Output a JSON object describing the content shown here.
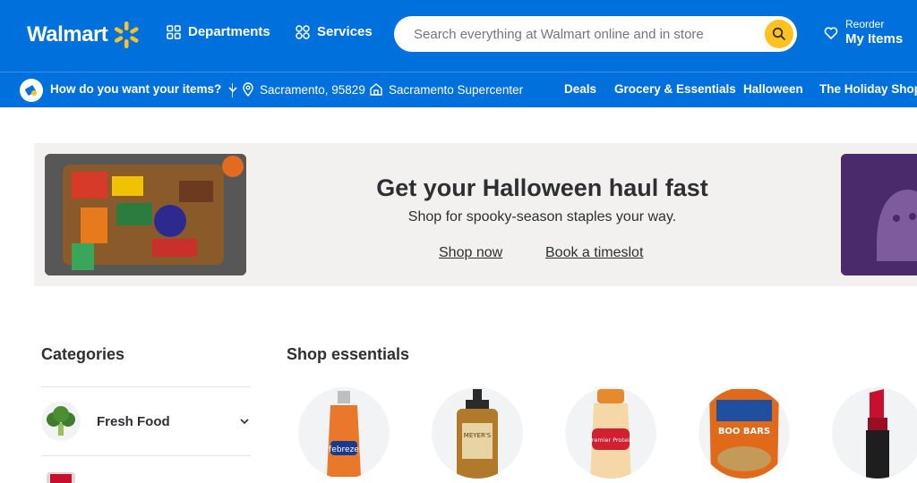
{
  "header": {
    "logo_text": "Walmart",
    "departments_label": "Departments",
    "services_label": "Services",
    "search_placeholder": "Search everything at Walmart online and in store",
    "reorder_small": "Reorder",
    "reorder_big": "My Items"
  },
  "subbar": {
    "delivery_prompt": "How do you want your items?",
    "location": "Sacramento, 95829",
    "store": "Sacramento Supercenter",
    "links": [
      "Deals",
      "Grocery & Essentials",
      "Halloween",
      "The Holiday Shop"
    ]
  },
  "banner": {
    "title": "Get your Halloween haul fast",
    "subtitle": "Shop for spooky-season staples your way.",
    "link_shop": "Shop now",
    "link_book": "Book a timeslot"
  },
  "categories": {
    "title": "Categories",
    "items": [
      {
        "label": "Fresh Food"
      }
    ]
  },
  "essentials": {
    "title": "Shop essentials",
    "products": [
      {
        "name": "febreze",
        "label": "febreze"
      },
      {
        "name": "hand-soap",
        "label": "MEYER'S"
      },
      {
        "name": "premier-protein",
        "label": "Premier Protein"
      },
      {
        "name": "blue-boo-bars",
        "label": "BOO BARS"
      },
      {
        "name": "lipstick",
        "label": ""
      }
    ]
  },
  "colors": {
    "brand_blue": "#0071dc",
    "spark_yellow": "#ffc220",
    "banner_bg": "#f2f1f0"
  },
  "icons": [
    "spark-icon",
    "grid-icon",
    "services-icon",
    "search-icon",
    "heart-icon",
    "delivery-icon",
    "chevron-down-icon",
    "location-pin-icon",
    "store-icon"
  ]
}
